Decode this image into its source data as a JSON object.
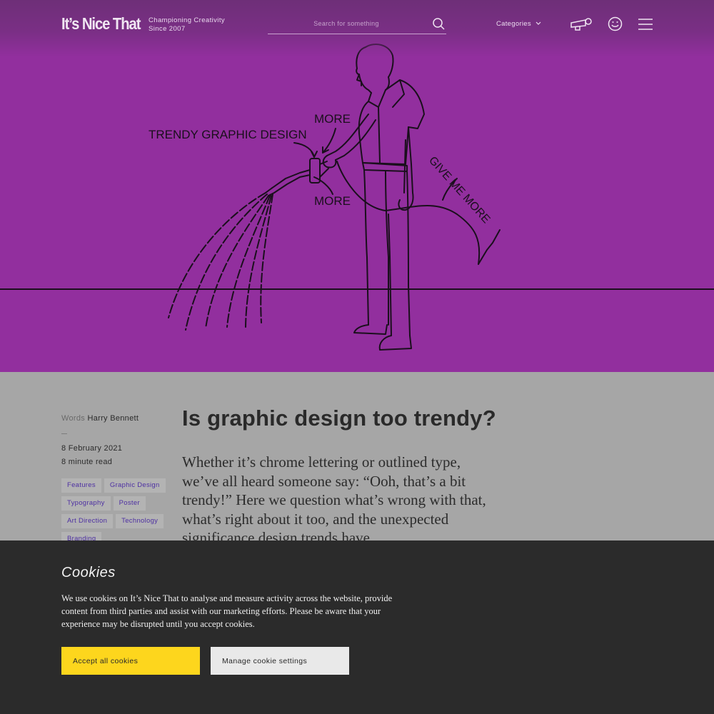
{
  "colors": {
    "hero_bg": "#922f9e",
    "page_bg": "#a6a6a6",
    "tag_text": "#4d2fa2",
    "accept_button": "#fdd61d",
    "cookie_banner": "#2b2b2b"
  },
  "header": {
    "logo": "It’s Nice That",
    "tagline_line1": "Championing Creativity",
    "tagline_line2": "Since 2007",
    "search_placeholder": "Search for something",
    "categories_label": "Categories",
    "icons": [
      "search-icon",
      "chevron-down-icon",
      "megaphone-icon",
      "smiley-icon",
      "hamburger-menu-icon"
    ]
  },
  "hero": {
    "label_trendy": "TRENDY GRAPHIC DESIGN",
    "label_more_top": "MORE",
    "label_more_bottom": "MORE",
    "label_give_me_more": "GIVE ME MORE"
  },
  "article": {
    "words_label": "Words",
    "author": "Harry Bennett",
    "date": "8 February 2021",
    "read_time": "8 minute read",
    "tags": [
      "Features",
      "Graphic Design",
      "Typography",
      "Poster",
      "Art Direction",
      "Technology",
      "Branding"
    ],
    "title": "Is graphic design too trendy?",
    "standfirst": "Whether it’s chrome lettering or outlined type, we’ve all heard someone say: “Ooh, that’s a bit trendy!” Here we question what’s wrong with that, what’s right about it too, and the unexpected significance design trends have."
  },
  "cookies": {
    "heading": "Cookies",
    "body": "We use cookies on It’s Nice That to analyse and measure activity across the website, provide content from third parties and assist with our marketing efforts. Please be aware that your experience may be disrupted until you accept cookies.",
    "accept_label": "Accept all cookies",
    "manage_label": "Manage cookie settings"
  }
}
